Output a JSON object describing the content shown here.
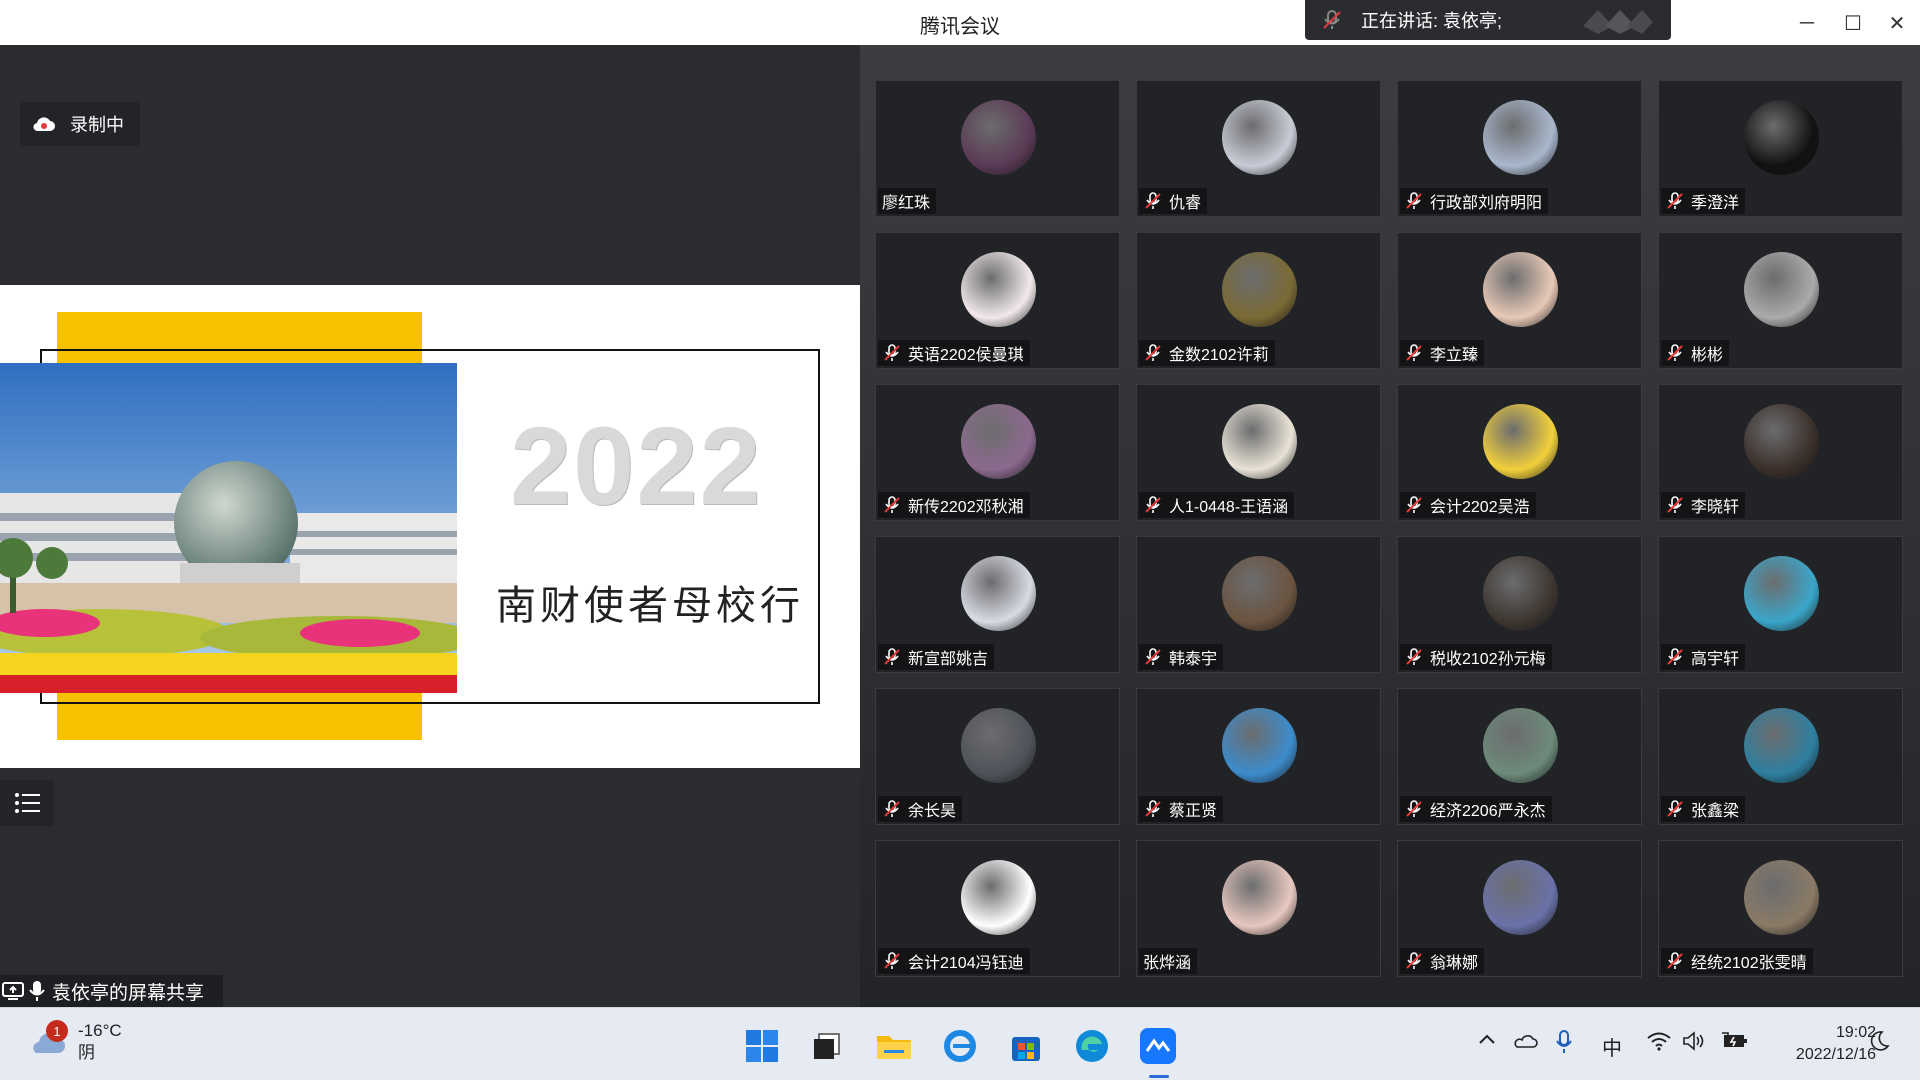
{
  "window": {
    "title": "腾讯会议",
    "speaking": "正在讲话: 袁依亭;",
    "minimize": "─",
    "maximize": "☐",
    "close": "✕"
  },
  "left": {
    "recording_label": "录制中",
    "share_label": "袁依亭的屏幕共享",
    "slide": {
      "year": "2022",
      "subtitle": "南财使者母校行"
    }
  },
  "participants": [
    {
      "name": "廖红珠",
      "muted": false,
      "color": "#5a3a55"
    },
    {
      "name": "仇睿",
      "muted": true,
      "color": "#c9cbd6"
    },
    {
      "name": "行政部刘府明阳",
      "muted": true,
      "color": "#a9b7cc"
    },
    {
      "name": "季澄洋",
      "muted": true,
      "color": "#111111"
    },
    {
      "name": "英语2202侯曼琪",
      "muted": true,
      "color": "#f2eaea"
    },
    {
      "name": "金数2102许莉",
      "muted": true,
      "color": "#7a6a34"
    },
    {
      "name": "李立臻",
      "muted": true,
      "color": "#e8c9b6"
    },
    {
      "name": "彬彬",
      "muted": true,
      "color": "#aaaaaa"
    },
    {
      "name": "新传2202邓秋湘",
      "muted": true,
      "color": "#8c6a8e"
    },
    {
      "name": "人1-0448-王语涵",
      "muted": true,
      "color": "#e9e3d6"
    },
    {
      "name": "会计2202吴浩",
      "muted": true,
      "color": "#f2d03b"
    },
    {
      "name": "李晓轩",
      "muted": true,
      "color": "#3a2f2a"
    },
    {
      "name": "新宣部姚吉",
      "muted": true,
      "color": "#d9dbe4"
    },
    {
      "name": "韩泰宇",
      "muted": true,
      "color": "#6b5440"
    },
    {
      "name": "税收2102孙元梅",
      "muted": true,
      "color": "#3d3630"
    },
    {
      "name": "高宇轩",
      "muted": true,
      "color": "#3aa6c9"
    },
    {
      "name": "余长昊",
      "muted": true,
      "color": "#4f5259"
    },
    {
      "name": "蔡正贤",
      "muted": true,
      "color": "#3c8ccc"
    },
    {
      "name": "经济2206严永杰",
      "muted": true,
      "color": "#6d8a7a"
    },
    {
      "name": "张鑫梁",
      "muted": true,
      "color": "#2e7fa0"
    },
    {
      "name": "会计2104冯钰迪",
      "muted": true,
      "color": "#ffffff"
    },
    {
      "name": "张烨涵",
      "muted": false,
      "color": "#e8c8bf"
    },
    {
      "name": "翁琳娜",
      "muted": true,
      "color": "#6a72a8"
    },
    {
      "name": "经统2102张雯晴",
      "muted": true,
      "color": "#8a7a66"
    }
  ],
  "taskbar": {
    "weather_temp": "-16°C",
    "weather_desc": "阴",
    "weather_badge": "1",
    "ime": "中",
    "time": "19:02",
    "date": "2022/12/16"
  }
}
